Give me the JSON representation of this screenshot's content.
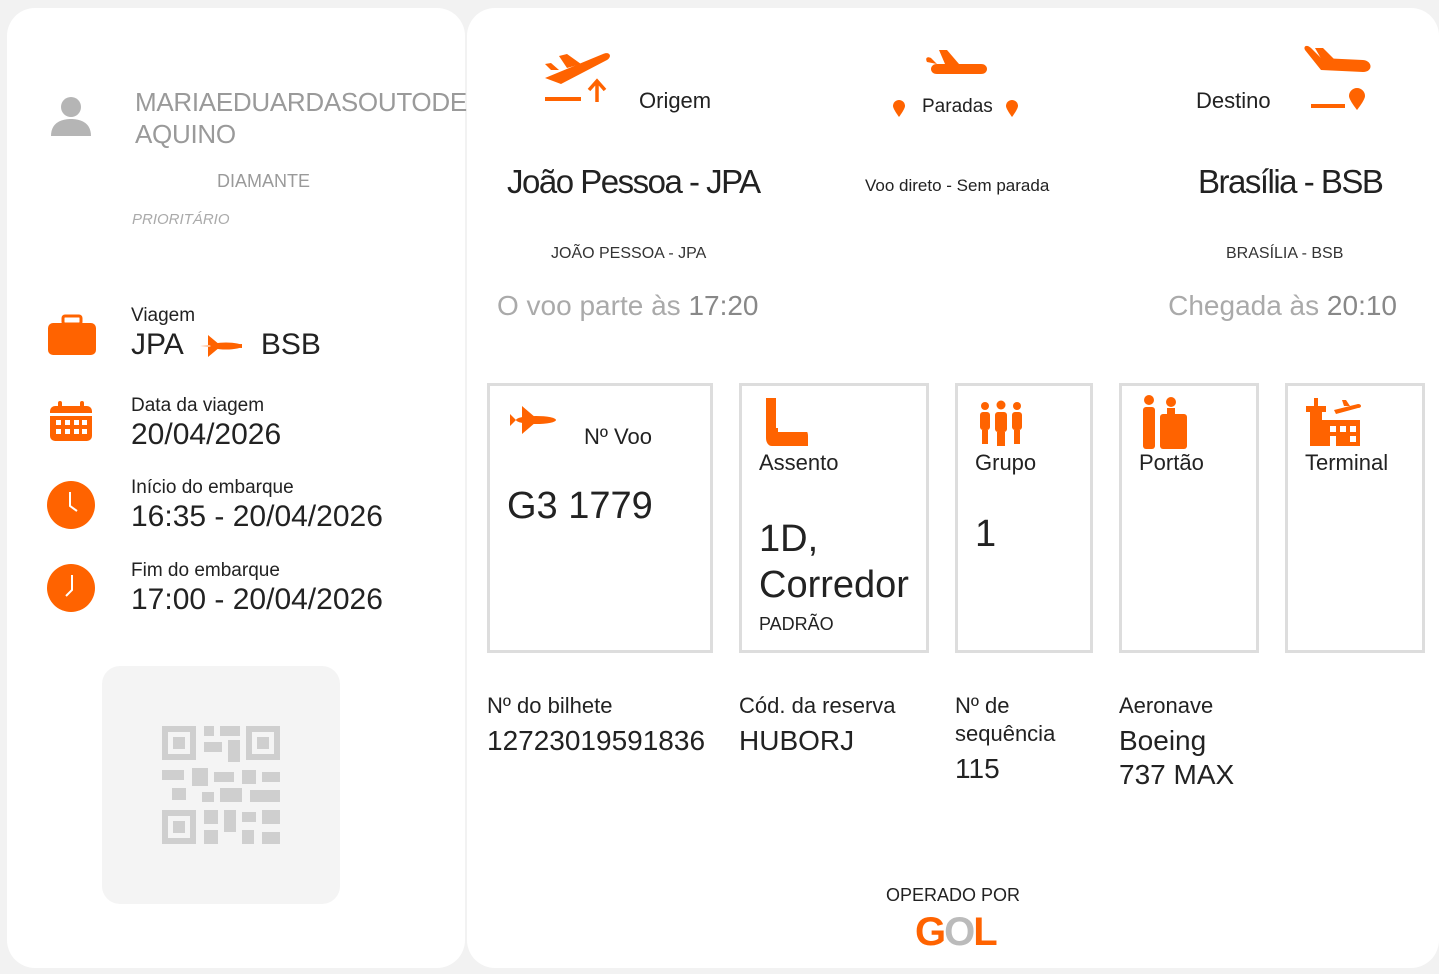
{
  "passenger": {
    "name": "MARIAEDUARDASOUTODE AQUINO",
    "tier": "DIAMANTE",
    "priority": "PRIORITÁRIO"
  },
  "trip": {
    "label": "Viagem",
    "from": "JPA",
    "to": "BSB",
    "date_label": "Data da viagem",
    "date": "20/04/2026",
    "boarding_start_label": "Início do embarque",
    "boarding_start": "16:35 - 20/04/2026",
    "boarding_end_label": "Fim do embarque",
    "boarding_end": "17:00 - 20/04/2026"
  },
  "route": {
    "origin_label": "Origem",
    "stops_label": "Paradas",
    "destination_label": "Destino",
    "origin_city": "João Pessoa - JPA",
    "origin_sub": "JOÃO PESSOA - JPA",
    "stops_text": "Voo direto - Sem parada",
    "destination_city": "Brasília - BSB",
    "destination_sub": "BRASÍLIA - BSB",
    "departure_prefix": "O voo parte às",
    "departure_time": "17:20",
    "arrival_prefix": "Chegada às",
    "arrival_time": "20:10"
  },
  "boxes": {
    "flight_label": "Nº Voo",
    "flight_value": "G3 1779",
    "seat_label": "Assento",
    "seat_value": "1D, Corredor",
    "seat_class": "PADRÃO",
    "group_label": "Grupo",
    "group_value": "1",
    "gate_label": "Portão",
    "terminal_label": "Terminal"
  },
  "details": {
    "ticket_label": "Nº do bilhete",
    "ticket_value": "12723019591836",
    "reservation_label": "Cód. da reserva",
    "reservation_value": "HUBORJ",
    "sequence_label": "Nº de sequência",
    "sequence_value": "115",
    "aircraft_label": "Aeronave",
    "aircraft_value": "Boeing 737 MAX"
  },
  "footer": {
    "operated_by": "OPERADO POR",
    "airline": "GOL"
  },
  "colors": {
    "accent": "#ff6300",
    "muted": "#9a9a9a",
    "border": "#dddddd"
  }
}
